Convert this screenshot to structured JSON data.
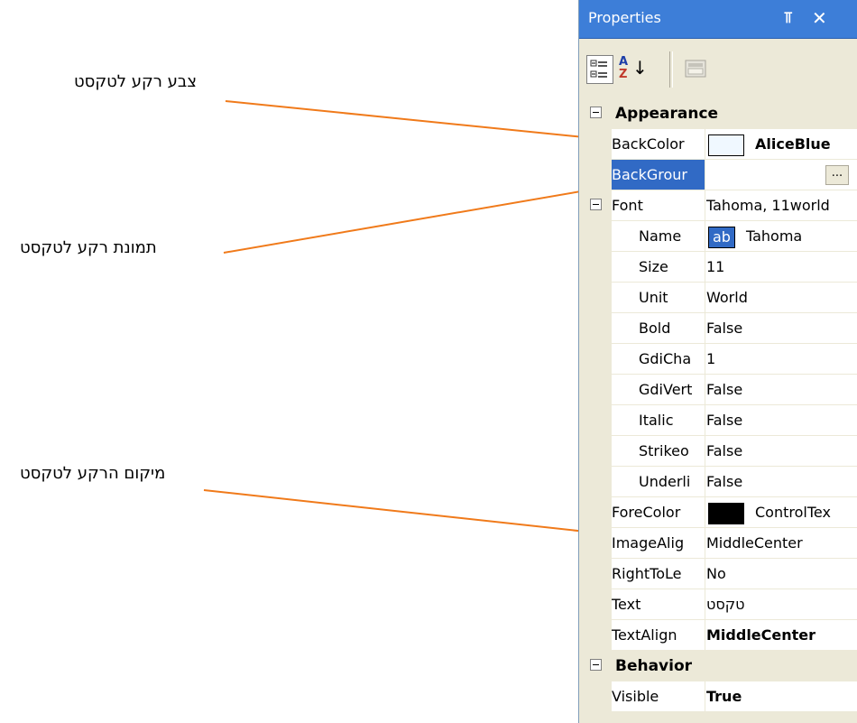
{
  "annotations": {
    "backcolor_note": "צבע רקע לטקסט",
    "backimage_note": "תמונת רקע לטקסט",
    "imagealign_note": "מיקום הרקע לטקסט"
  },
  "panel": {
    "title": "Properties",
    "pin_icon": "pin-icon",
    "close_icon": "close-icon",
    "toolbar": {
      "categorized_icon": "categorized-icon",
      "alphabetical_icon": "alphabetical-icon",
      "property_pages_icon": "property-pages-icon",
      "az_a": "A",
      "az_z": "Z"
    }
  },
  "grid": {
    "appearance_label": "Appearance",
    "backcolor": {
      "name": "BackColor",
      "value": "AliceBlue",
      "swatch": "#f0f8ff"
    },
    "backgroundimage": {
      "name": "BackGrour",
      "value": "",
      "button": "..."
    },
    "font": {
      "name": "Font",
      "value": "Tahoma, 11world"
    },
    "font_name": {
      "name": "Name",
      "sample": "ab",
      "value": "Tahoma"
    },
    "font_size": {
      "name": "Size",
      "value": "11"
    },
    "font_unit": {
      "name": "Unit",
      "value": "World"
    },
    "font_bold": {
      "name": "Bold",
      "value": "False"
    },
    "font_gdicharset": {
      "name": "GdiCha",
      "value": "1"
    },
    "font_gdivertical": {
      "name": "GdiVert",
      "value": "False"
    },
    "font_italic": {
      "name": "Italic",
      "value": "False"
    },
    "font_strikeout": {
      "name": "Strikeo",
      "value": "False"
    },
    "font_underline": {
      "name": "Underli",
      "value": "False"
    },
    "forecolor": {
      "name": "ForeColor",
      "value": "ControlTex",
      "swatch": "#000000"
    },
    "imagealign": {
      "name": "ImageAlig",
      "value": "MiddleCenter"
    },
    "righttoleft": {
      "name": "RightToLe",
      "value": "No"
    },
    "text": {
      "name": "Text",
      "value": "טקסט"
    },
    "textalign": {
      "name": "TextAlign",
      "value": "MiddleCenter"
    },
    "behavior_label": "Behavior",
    "visible": {
      "name": "Visible",
      "value": "True"
    }
  },
  "colors": {
    "arrow": "#f07a1a",
    "title_bar": "#3d7ed8",
    "selection": "#316ac5"
  }
}
